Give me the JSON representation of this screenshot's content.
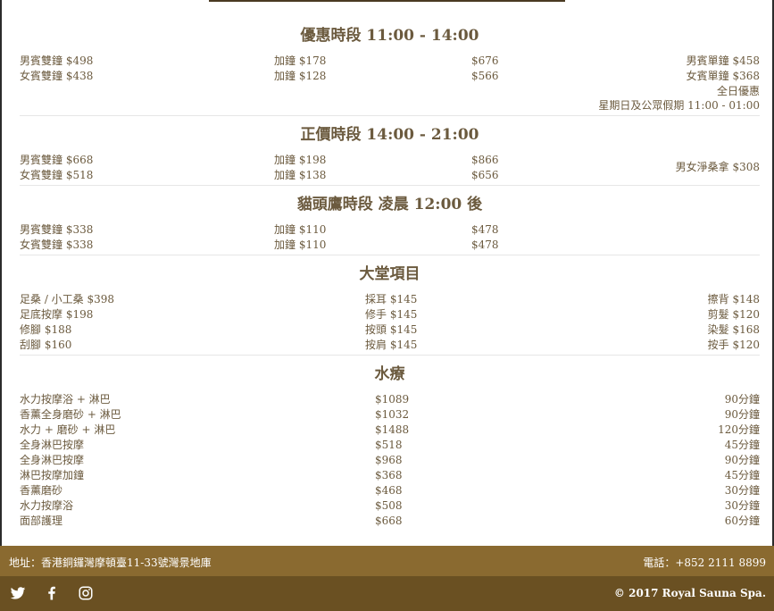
{
  "sections": [
    {
      "title": "優惠時段 11:00 - 14:00",
      "rows": [
        [
          "男賓雙鐘 $498",
          "加鐘 $178",
          "$676",
          "男賓單鐘 $458"
        ],
        [
          "女賓雙鐘 $438",
          "加鐘 $128",
          "$566",
          "女賓單鐘 $368"
        ]
      ],
      "extra": [
        "全日優惠",
        "星期日及公眾假期 11:00 - 01:00"
      ]
    },
    {
      "title": "正價時段 14:00 - 21:00",
      "rows": [
        [
          "男賓雙鐘 $668",
          "加鐘 $198",
          "$866"
        ],
        [
          "女賓雙鐘 $518",
          "加鐘 $138",
          "$656"
        ]
      ],
      "side": "男女淨桑拿 $308"
    },
    {
      "title": "貓頭鷹時段 凌晨 12:00 後",
      "rows": [
        [
          "男賓雙鐘 $338",
          "加鐘 $110",
          "$478"
        ],
        [
          "女賓雙鐘 $338",
          "加鐘 $110",
          "$478"
        ]
      ]
    },
    {
      "title": "大堂項目",
      "rows": [
        [
          "足桑 / 小工桑 $398",
          "採耳 $145",
          "擦背 $148"
        ],
        [
          "足底按摩 $198",
          "修手 $145",
          "剪髮 $120"
        ],
        [
          "修腳 $188",
          "按頭 $145",
          "染髮 $168"
        ],
        [
          "刮腳 $160",
          "按肩 $145",
          "按手 $120"
        ]
      ]
    },
    {
      "title": "水療",
      "rows": [
        [
          "水力按摩浴 + 淋巴",
          "$1089",
          "90分鐘"
        ],
        [
          "香薰全身磨砂 + 淋巴",
          "$1032",
          "90分鐘"
        ],
        [
          "水力 + 磨砂 + 淋巴",
          "$1488",
          "120分鐘"
        ],
        [
          "全身淋巴按摩",
          "$518",
          "45分鐘"
        ],
        [
          "全身淋巴按摩",
          "$968",
          "90分鐘"
        ],
        [
          "淋巴按摩加鐘",
          "$368",
          "45分鐘"
        ],
        [
          "香薰磨砂",
          "$468",
          "30分鐘"
        ],
        [
          "水力按摩浴",
          "$508",
          "30分鐘"
        ],
        [
          "面部護理",
          "$668",
          "60分鐘"
        ]
      ]
    }
  ],
  "footer": {
    "address": "地址：香港銅鑼灣摩頓臺11-33號灣景地庫",
    "phone": "電話：+852 2111 8899",
    "copyright": "© 2017 Royal Sauna Spa."
  },
  "social_icons": [
    "twitter-icon",
    "facebook-icon",
    "instagram-icon"
  ],
  "colors": {
    "text": "#6b5a3e",
    "footer_top": "#8a6a30",
    "footer_bottom": "#6a5022"
  }
}
